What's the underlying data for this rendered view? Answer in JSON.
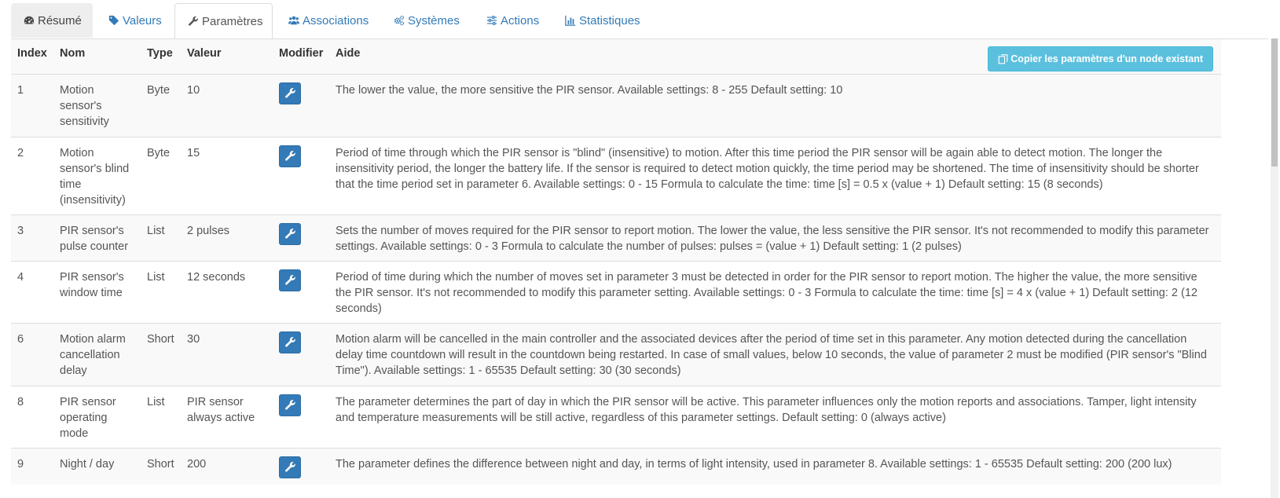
{
  "tabs": [
    {
      "label": "Résumé",
      "icon": "dashboard-icon"
    },
    {
      "label": "Valeurs",
      "icon": "tag-icon"
    },
    {
      "label": "Paramètres",
      "icon": "wrench-icon"
    },
    {
      "label": "Associations",
      "icon": "users-icon"
    },
    {
      "label": "Systèmes",
      "icon": "cogs-icon"
    },
    {
      "label": "Actions",
      "icon": "sliders-icon"
    },
    {
      "label": "Statistiques",
      "icon": "bar-chart-icon"
    }
  ],
  "active_tab": "Paramètres",
  "table": {
    "headers": {
      "index": "Index",
      "name": "Nom",
      "type": "Type",
      "value": "Valeur",
      "edit": "Modifier",
      "help": "Aide"
    },
    "copy_button_label": "Copier les paramètres d'un node existant",
    "rows": [
      {
        "index": "1",
        "name": "Motion sensor's sensitivity",
        "type": "Byte",
        "value": "10",
        "help": "The lower the value, the more sensitive the PIR sensor. Available settings: 8 - 255 Default setting: 10"
      },
      {
        "index": "2",
        "name": "Motion sensor's blind time (insensitivity)",
        "type": "Byte",
        "value": "15",
        "help": "Period of time through which the PIR sensor is \"blind\" (insensitive) to motion. After this time period the PIR sensor will be again able to detect motion. The longer the insensitivity period, the longer the battery life. If the sensor is required to detect motion quickly, the time period may be shortened. The time of insensitivity should be shorter that the time period set in parameter 6. Available settings: 0 - 15 Formula to calculate the time: time [s] = 0.5 x (value + 1) Default setting: 15 (8 seconds)"
      },
      {
        "index": "3",
        "name": "PIR sensor's pulse counter",
        "type": "List",
        "value": "2 pulses",
        "help": "Sets the number of moves required for the PIR sensor to report motion. The lower the value, the less sensitive the PIR sensor. It's not recommended to modify this parameter settings. Available settings: 0 - 3 Formula to calculate the number of pulses: pulses = (value + 1) Default setting: 1 (2 pulses)"
      },
      {
        "index": "4",
        "name": "PIR sensor's window time",
        "type": "List",
        "value": "12 seconds",
        "help": "Period of time during which the number of moves set in parameter 3 must be detected in order for the PIR sensor to report motion. The higher the value, the more sensitive the PIR sensor. It's not recommended to modify this parameter setting. Available settings: 0 - 3 Formula to calculate the time: time [s] = 4 x (value + 1) Default setting: 2 (12 seconds)"
      },
      {
        "index": "6",
        "name": "Motion alarm cancellation delay",
        "type": "Short",
        "value": "30",
        "help": "Motion alarm will be cancelled in the main controller and the associated devices after the period of time set in this parameter. Any motion detected during the cancellation delay time countdown will result in the countdown being restarted. In case of small values, below 10 seconds, the value of parameter 2 must be modified (PIR sensor's \"Blind Time\"). Available settings: 1 - 65535 Default setting: 30 (30 seconds)"
      },
      {
        "index": "8",
        "name": "PIR sensor operating mode",
        "type": "List",
        "value": "PIR sensor always active",
        "help": "The parameter determines the part of day in which the PIR sensor will be active. This parameter influences only the motion reports and associations. Tamper, light intensity and temperature measurements will be still active, regardless of this parameter settings. Default setting: 0 (always active)"
      },
      {
        "index": "9",
        "name": "Night / day",
        "type": "Short",
        "value": "200",
        "help": "The parameter defines the difference between night and day, in terms of light intensity, used in parameter 8. Available settings: 1 - 65535 Default setting: 200 (200 lux)"
      }
    ]
  },
  "colors": {
    "link": "#337ab7",
    "primary_button": "#337ab7",
    "info_button": "#5bc0de",
    "row_striped": "#f9f9f9",
    "border": "#dddddd"
  }
}
